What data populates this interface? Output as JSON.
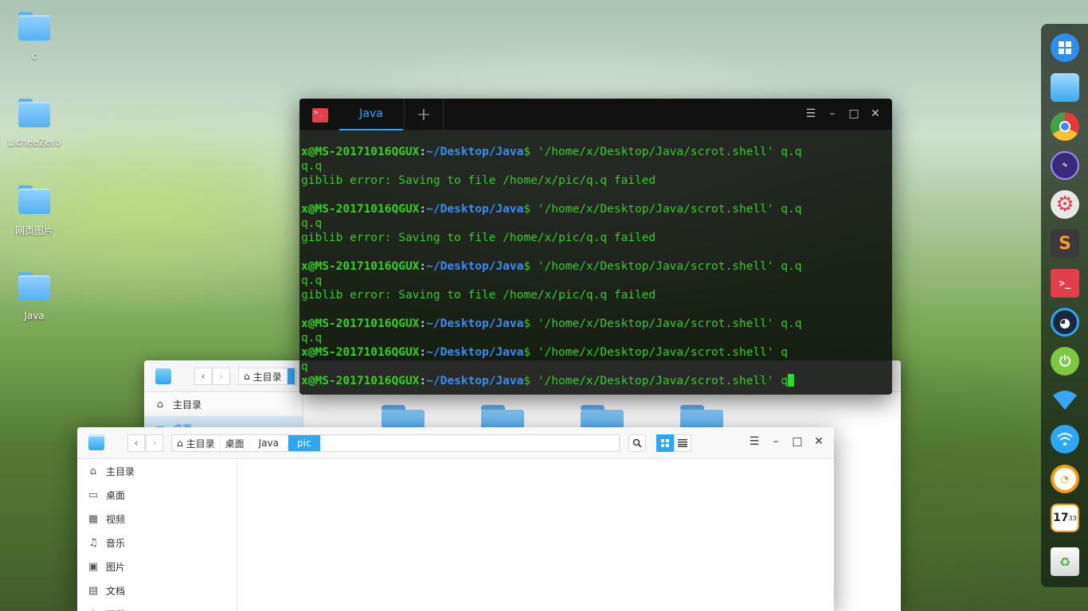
{
  "desktop": {
    "icons": [
      {
        "label": "c"
      },
      {
        "label": "LicheeZero"
      },
      {
        "label": "网页图片"
      },
      {
        "label": "Java"
      }
    ]
  },
  "terminal": {
    "tab_label": "Java",
    "new_tab": "+",
    "lines": [
      {
        "user": "x@MS-20171016QGUX",
        "sep": ":",
        "path": "~/Desktop/Java",
        "cmd": "$ '/home/x/Desktop/Java/scrot.shell' q.q"
      },
      {
        "text": "q.q"
      },
      {
        "text": "giblib error: Saving to file /home/x/pic/q.q failed"
      },
      {
        "text": ""
      },
      {
        "user": "x@MS-20171016QGUX",
        "sep": ":",
        "path": "~/Desktop/Java",
        "cmd": "$ '/home/x/Desktop/Java/scrot.shell' q.q"
      },
      {
        "text": "q.q"
      },
      {
        "text": "giblib error: Saving to file /home/x/pic/q.q failed"
      },
      {
        "text": ""
      },
      {
        "user": "x@MS-20171016QGUX",
        "sep": ":",
        "path": "~/Desktop/Java",
        "cmd": "$ '/home/x/Desktop/Java/scrot.shell' q.q"
      },
      {
        "text": "q.q"
      },
      {
        "text": "giblib error: Saving to file /home/x/pic/q.q failed"
      },
      {
        "text": ""
      },
      {
        "user": "x@MS-20171016QGUX",
        "sep": ":",
        "path": "~/Desktop/Java",
        "cmd": "$ '/home/x/Desktop/Java/scrot.shell' q.q"
      },
      {
        "text": "q.q"
      },
      {
        "user": "x@MS-20171016QGUX",
        "sep": ":",
        "path": "~/Desktop/Java",
        "cmd": "$ '/home/x/Desktop/Java/scrot.shell' q"
      },
      {
        "text": "q"
      },
      {
        "user": "x@MS-20171016QGUX",
        "sep": ":",
        "path": "~/Desktop/Java",
        "cmd": "$ '/home/x/Desktop/Java/scrot.shell' q",
        "cursor": true
      }
    ]
  },
  "fm_back": {
    "home_crumb": "主目录",
    "sidebar": [
      {
        "label": "主目录"
      },
      {
        "label": "桌面"
      }
    ]
  },
  "fm_front": {
    "crumbs": [
      "主目录",
      "桌面",
      "Java",
      "pic"
    ],
    "sidebar": [
      {
        "label": "主目录",
        "icon": "⌂"
      },
      {
        "label": "桌面",
        "icon": "▭"
      },
      {
        "label": "视频",
        "icon": "▦"
      },
      {
        "label": "音乐",
        "icon": "♫"
      },
      {
        "label": "图片",
        "icon": "▣"
      },
      {
        "label": "文档",
        "icon": "▤"
      },
      {
        "label": "下载",
        "icon": "↓"
      }
    ]
  },
  "dock": {
    "items": [
      "launcher-icon",
      "file-manager-icon",
      "chrome-icon",
      "cpu-monitor-icon",
      "settings-icon",
      "sublime-text-icon",
      "terminal-icon",
      "qq-icon",
      "power-icon",
      "wifi-icon",
      "network-icon",
      "music-icon",
      "clock-icon",
      "trash-icon"
    ]
  },
  "clock": {
    "hour": "17",
    "min": "33"
  }
}
